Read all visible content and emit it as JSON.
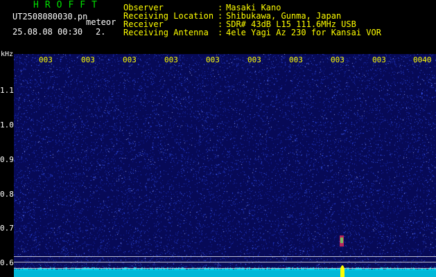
{
  "header": {
    "app_title": "HROFFT",
    "file_name": "UT2508080030.pn",
    "meteor_label": "meteor",
    "timestamp": "25.08.08 00:30",
    "count": "2."
  },
  "info": [
    {
      "key": "Observer",
      "value": "Masaki Kano"
    },
    {
      "key": "Receiving Location",
      "value": "Shibukawa, Gunma, Japan"
    },
    {
      "key": "Receiver",
      "value": "SDR# 43dB L15 111.6MHz USB"
    },
    {
      "key": "Receiving Antenna",
      "value": "4ele Yagi Az 230 for Kansai VOR"
    }
  ],
  "axis": {
    "unit": "kHz",
    "y_ticks": [
      "1.1",
      "1.0",
      "0.9",
      "0.8",
      "0.7",
      "0.6"
    ],
    "x_ticks": [
      "003",
      "003",
      "003",
      "003",
      "003",
      "003",
      "003",
      "003",
      "003",
      "0040"
    ]
  },
  "colors": {
    "background": "#070a57",
    "echo": "#ffff00",
    "baseline": "#00b8d8"
  }
}
